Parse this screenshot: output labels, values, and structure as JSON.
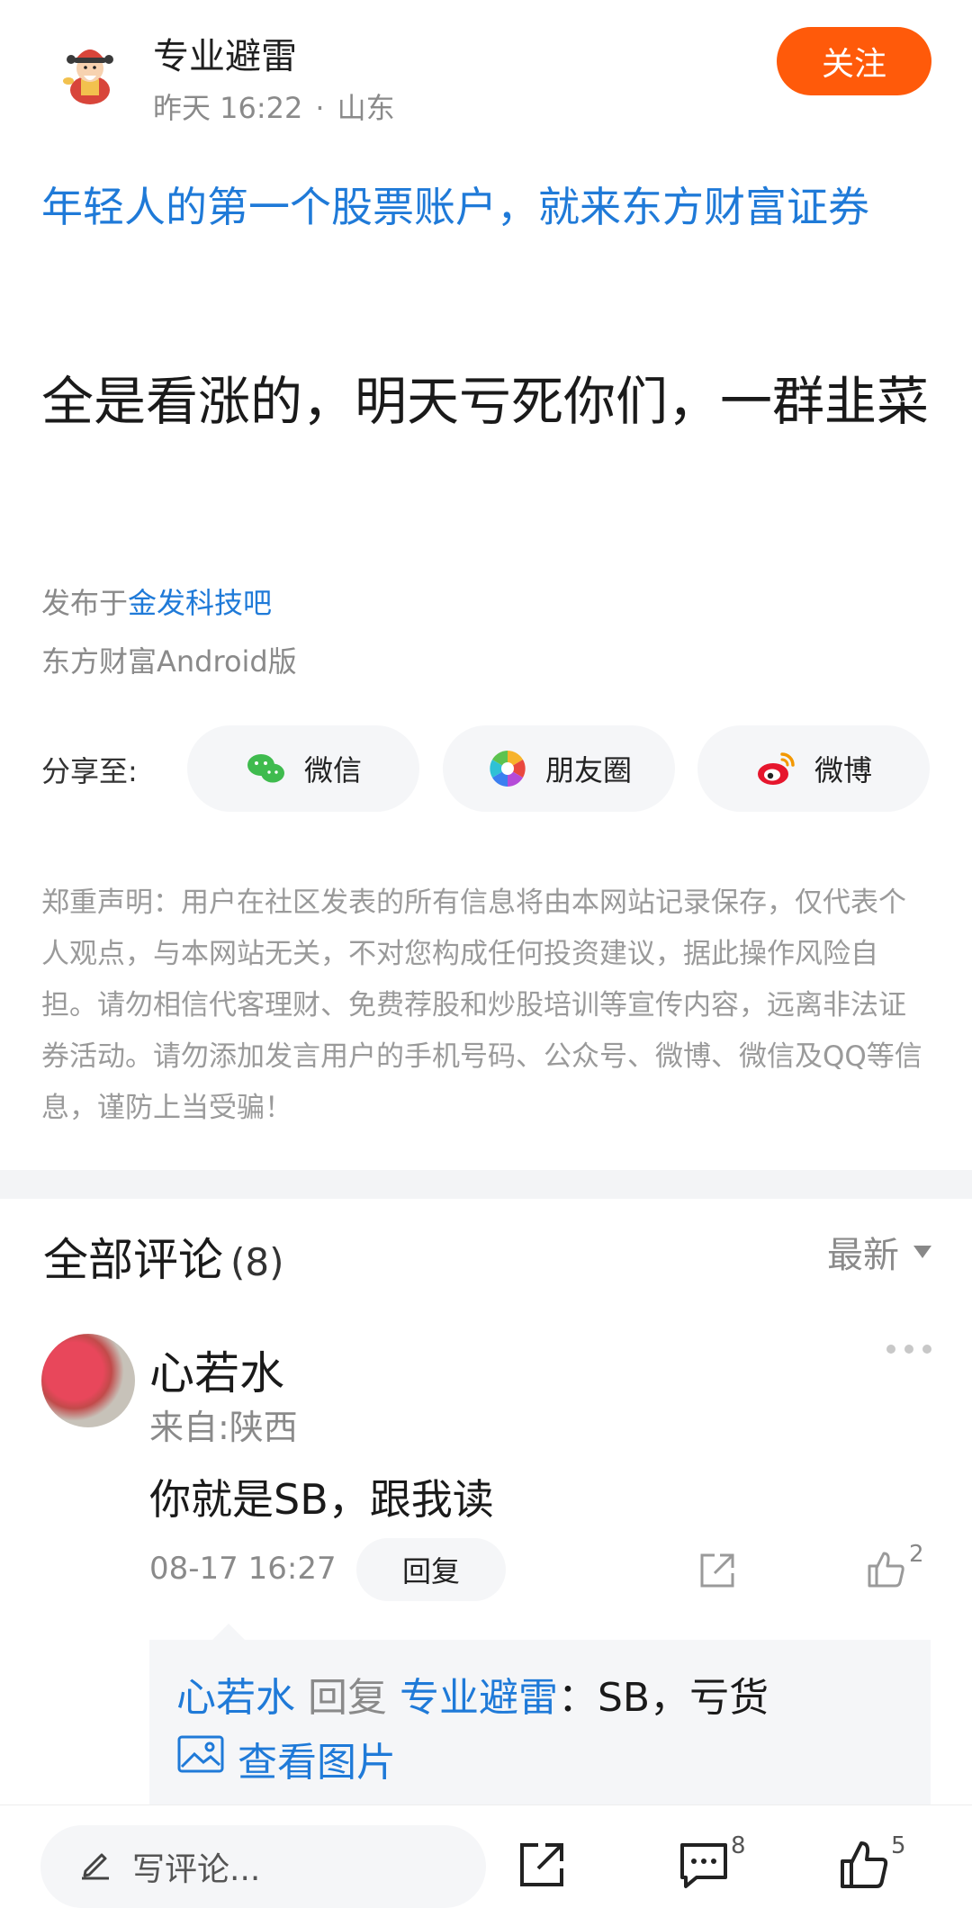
{
  "header": {
    "author_name": "专业避雷",
    "time": "昨天 16:22",
    "separator": "·",
    "location": "山东",
    "follow_label": "关注"
  },
  "post": {
    "promo_title": "年轻人的第一个股票账户，就来东方财富证券",
    "body": "全是看涨的，明天亏死你们，一群韭菜",
    "published_prefix": "发布于",
    "bar_name": "金发科技吧",
    "source": "东方财富Android版"
  },
  "share": {
    "label": "分享至:",
    "items": [
      {
        "label": "微信",
        "icon": "wechat-icon"
      },
      {
        "label": "朋友圈",
        "icon": "moments-icon"
      },
      {
        "label": "微博",
        "icon": "weibo-icon"
      }
    ]
  },
  "disclaimer": "郑重声明：用户在社区发表的所有信息将由本网站记录保存，仅代表个人观点，与本网站无关，不对您构成任何投资建议，据此操作风险自担。请勿相信代客理财、免费荐股和炒股培训等宣传内容，远离非法证券活动。请勿添加发言用户的手机号码、公众号、微博、微信及QQ等信息，谨防上当受骗！",
  "comments": {
    "title": "全部评论",
    "count": "(8)",
    "sort_label": "最新",
    "items": [
      {
        "user": "心若水",
        "location": "来自:陕西",
        "text": "你就是SB，跟我读",
        "time": "08-17 16:27",
        "reply_label": "回复",
        "like_count": "2",
        "sub_reply": {
          "from": "心若水",
          "verb": "回复",
          "to": "专业避雷",
          "text": "：SB，亏货",
          "view_image": "查看图片"
        }
      }
    ]
  },
  "bottom_bar": {
    "write_placeholder": "写评论...",
    "comment_count": "8",
    "like_count": "5"
  },
  "colors": {
    "accent": "#ff5a0a",
    "link": "#1f7ad8",
    "muted": "#8a8a8a"
  }
}
